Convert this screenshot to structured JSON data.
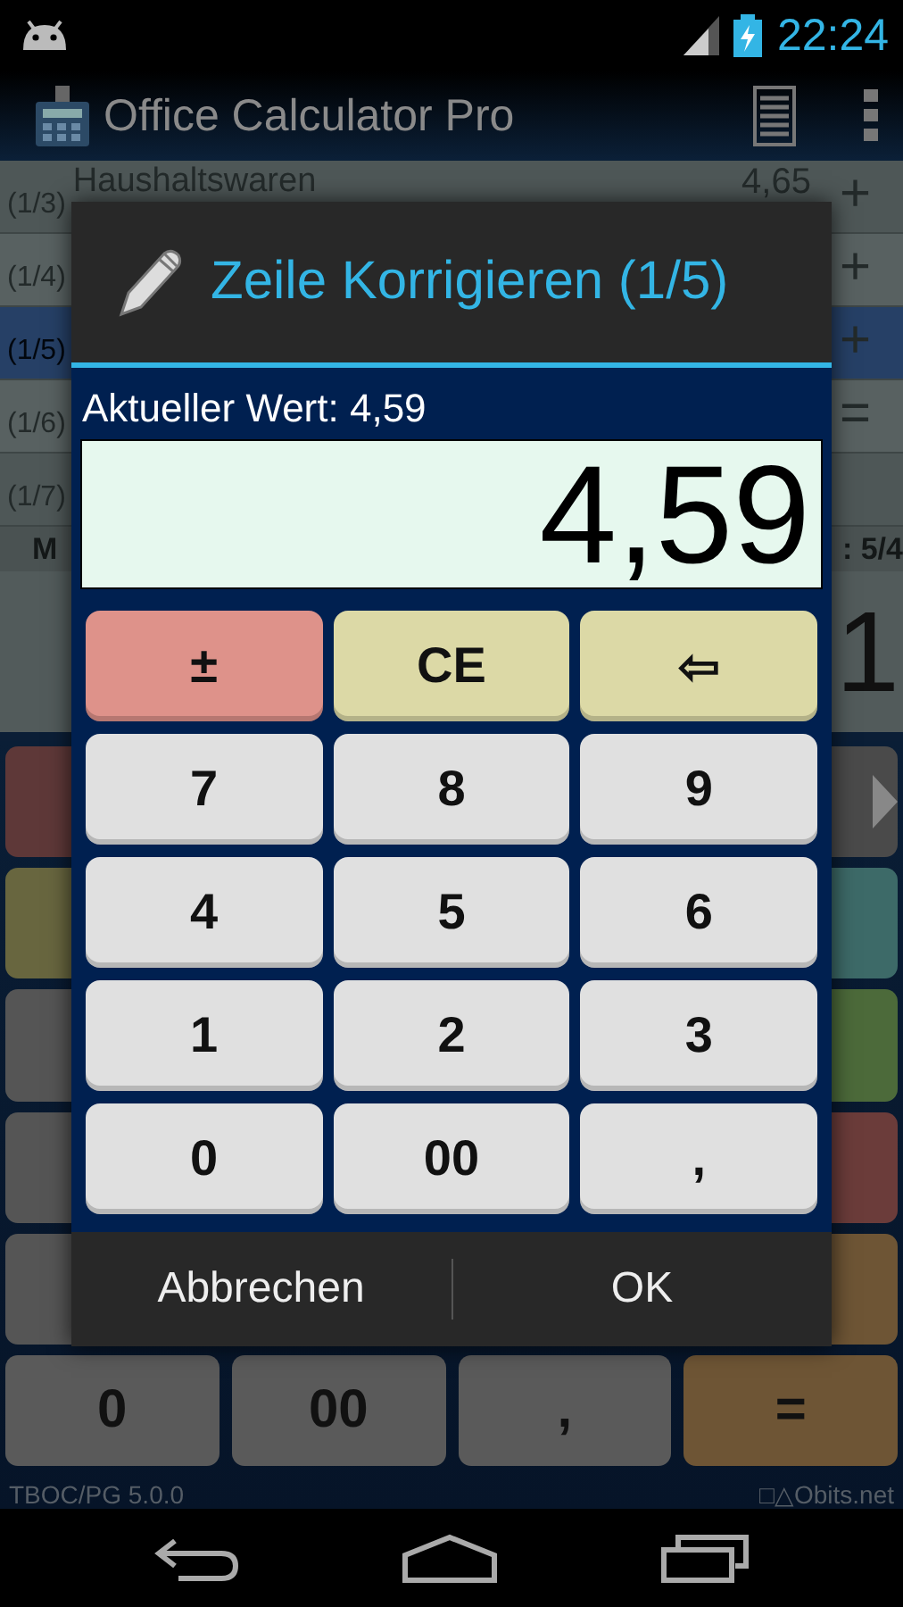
{
  "status_bar": {
    "time": "22:24"
  },
  "action_bar": {
    "title": "Office Calculator Pro"
  },
  "tape": {
    "rows": [
      {
        "index": "(1/3)",
        "name": "Haushaltswaren",
        "value": "4,65",
        "operator": "+",
        "selected": false
      },
      {
        "index": "(1/4)",
        "operator": "+",
        "selected": false
      },
      {
        "index": "(1/5)",
        "operator": "+",
        "selected": true
      },
      {
        "index": "(1/6)",
        "operator": "=",
        "selected": false
      },
      {
        "index": "(1/7)",
        "selected": false
      }
    ]
  },
  "memory_bar": {
    "left": "M",
    "right": ": 5/4"
  },
  "display": {
    "value": "1"
  },
  "keypad": {
    "rows": [
      [
        {
          "color": "#5e3838"
        },
        {
          "color": "#4a4a4a",
          "kind": "scroll"
        }
      ],
      [
        {
          "color": "#68663f"
        },
        {
          "color": "#3d6a68"
        }
      ],
      [
        {
          "color": "#555555"
        },
        {
          "color": "#4c6a3a"
        }
      ],
      [
        {
          "color": "#555555"
        },
        {
          "color": "#6b3c3a"
        }
      ],
      [
        {
          "color": "#555555"
        },
        {
          "color": "#6e5535"
        }
      ],
      [
        {
          "color": "#5a5a5a",
          "label": "0"
        },
        {
          "color": "#5a5a5a",
          "label": "00"
        },
        {
          "color": "#5a5a5a",
          "label": ","
        },
        {
          "color": "#6e5535",
          "label": "="
        }
      ]
    ]
  },
  "footer": {
    "version": "TBOC/PG 5.0.0",
    "brand": "□△Obits.net"
  },
  "dialog": {
    "title": "Zeile Korrigieren (1/5)",
    "current_label": "Aktueller Wert: 4,59",
    "value": "4,59",
    "keys": [
      {
        "label": "±",
        "kind": "sign"
      },
      {
        "label": "CE",
        "kind": "edit"
      },
      {
        "label": "⇦",
        "kind": "edit"
      },
      {
        "label": "7",
        "kind": "digit"
      },
      {
        "label": "8",
        "kind": "digit"
      },
      {
        "label": "9",
        "kind": "digit"
      },
      {
        "label": "4",
        "kind": "digit"
      },
      {
        "label": "5",
        "kind": "digit"
      },
      {
        "label": "6",
        "kind": "digit"
      },
      {
        "label": "1",
        "kind": "digit"
      },
      {
        "label": "2",
        "kind": "digit"
      },
      {
        "label": "3",
        "kind": "digit"
      },
      {
        "label": "0",
        "kind": "digit"
      },
      {
        "label": "00",
        "kind": "digit"
      },
      {
        "label": ",",
        "kind": "digit"
      }
    ],
    "buttons": [
      "Abbrechen",
      "OK"
    ]
  }
}
